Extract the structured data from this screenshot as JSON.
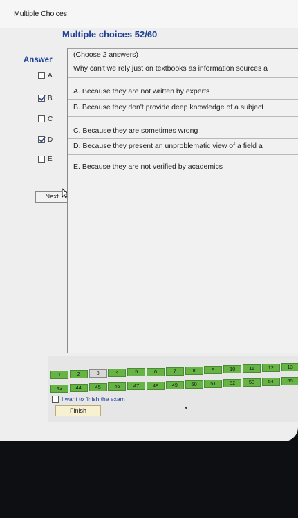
{
  "window": {
    "title": "Multiple Choices"
  },
  "exam": {
    "heading": "Multiple choices 52/60"
  },
  "answer_panel": {
    "label": "Answer",
    "options": [
      {
        "letter": "A",
        "checked": false
      },
      {
        "letter": "B",
        "checked": true
      },
      {
        "letter": "C",
        "checked": false
      },
      {
        "letter": "D",
        "checked": true
      },
      {
        "letter": "E",
        "checked": false
      }
    ],
    "next_label": "Next"
  },
  "question": {
    "instruction": "(Choose 2 answers)",
    "prompt": "Why can't we rely just on textbooks as information sources a",
    "choices": [
      "A. Because they are not written by experts",
      "B. Because they don't provide deep knowledge of a subject",
      "C. Because they are sometimes wrong",
      "D. Because they present an unproblematic view of a field a",
      "E. Because they are not verified by academics"
    ]
  },
  "navigation": {
    "row1": [
      "1",
      "2",
      "3",
      "4",
      "5",
      "6",
      "7",
      "8",
      "9",
      "10",
      "11",
      "12",
      "13"
    ],
    "row2": [
      "43",
      "44",
      "45",
      "46",
      "47",
      "48",
      "49",
      "50",
      "51",
      "52",
      "53",
      "54",
      "55"
    ],
    "current_label": "3",
    "finish_checkbox_label": "I want to finish the exam",
    "finish_checked": false,
    "finish_button": "Finish"
  },
  "colors": {
    "heading_blue": "#1d3f96",
    "answered_green": "#66b544",
    "finish_button_bg": "#f7f1d2"
  },
  "icons": {
    "cursor": "arrow-pointer-icon",
    "check": "checkmark-icon"
  }
}
